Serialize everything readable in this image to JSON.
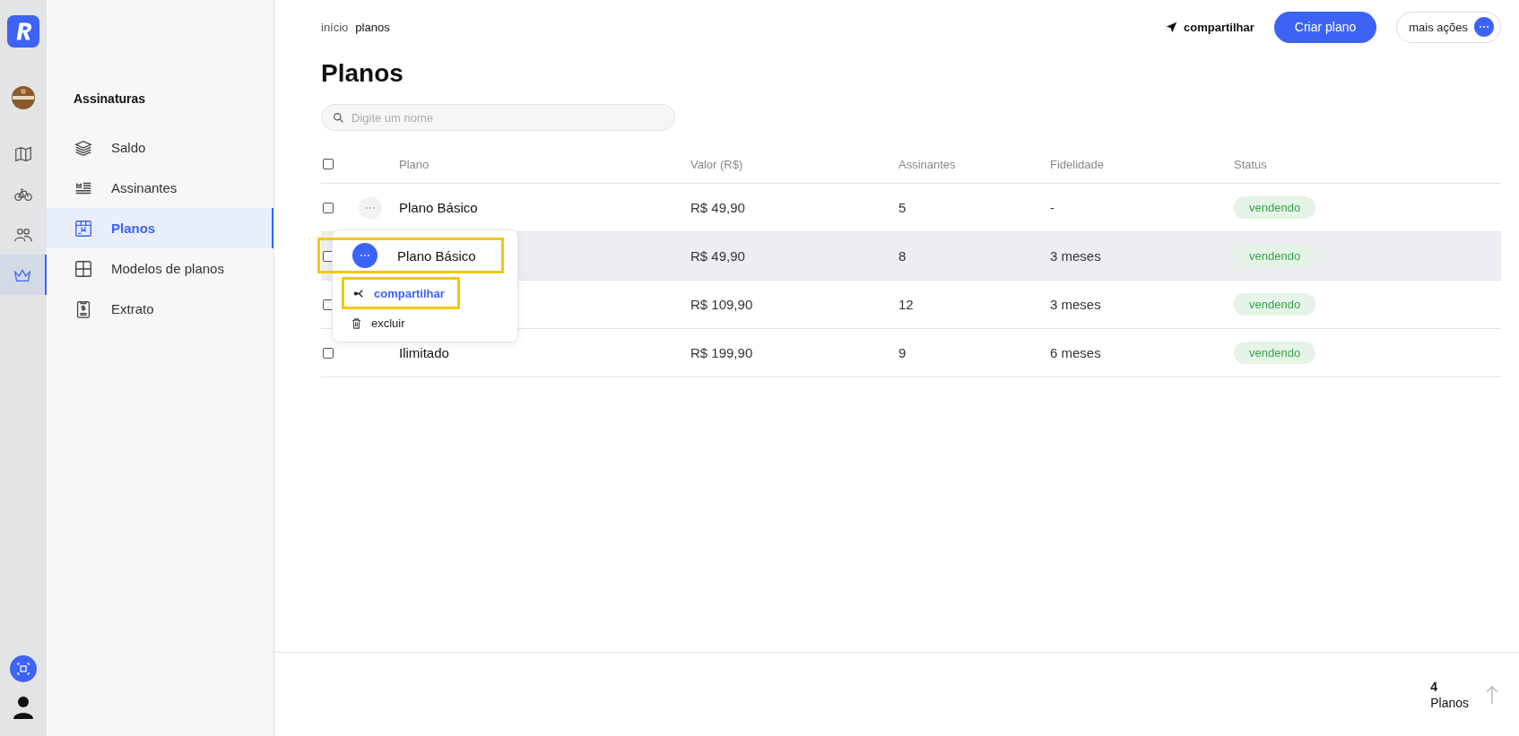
{
  "rail": {
    "items": [
      {
        "kind": "map",
        "selected": false
      },
      {
        "kind": "bike",
        "selected": false
      },
      {
        "kind": "people",
        "selected": false
      },
      {
        "kind": "crown",
        "selected": true
      }
    ]
  },
  "sidebar": {
    "title": "Assinaturas",
    "items": [
      {
        "kind": "money",
        "label": "Saldo",
        "selected": false
      },
      {
        "kind": "list",
        "label": "Assinantes",
        "selected": false
      },
      {
        "kind": "store",
        "label": "Planos",
        "selected": true
      },
      {
        "kind": "grid",
        "label": "Modelos de planos",
        "selected": false
      },
      {
        "kind": "receipt",
        "label": "Extrato",
        "selected": false
      }
    ]
  },
  "breadcrumb": [
    "início",
    "planos"
  ],
  "actions": {
    "share": "compartilhar",
    "create": "Criar plano",
    "more": "mais ações"
  },
  "title": "Planos",
  "search": {
    "placeholder": "Digite um nome"
  },
  "table": {
    "all_checked": false,
    "columns": [
      "Plano",
      "Valor (R$)",
      "Assinantes",
      "Fidelidade",
      "Status"
    ],
    "rows": [
      {
        "name": "Plano Básico",
        "price": "R$ 49,90",
        "subscribers": "5",
        "loyalty": "-",
        "status": "vendendo",
        "checked": false,
        "selected": false
      },
      {
        "price": "R$ 49,90",
        "subscribers": "8",
        "loyalty": "3 meses",
        "status": "vendendo",
        "checked": false,
        "selected": true
      },
      {
        "price": "R$ 109,90",
        "subscribers": "12",
        "loyalty": "3 meses",
        "status": "vendendo",
        "checked": false,
        "selected": false
      },
      {
        "name": "Ilimitado",
        "price": "R$ 199,90",
        "subscribers": "9",
        "loyalty": "6 meses",
        "status": "vendendo",
        "checked": false,
        "selected": false
      }
    ]
  },
  "menu": {
    "title": "Plano Básico",
    "items": [
      {
        "kind": "share",
        "label": "compartilhar",
        "selected": true
      },
      {
        "kind": "delete",
        "label": "excluir",
        "selected": false
      }
    ]
  },
  "footer": {
    "count": "4",
    "label": "Planos"
  }
}
